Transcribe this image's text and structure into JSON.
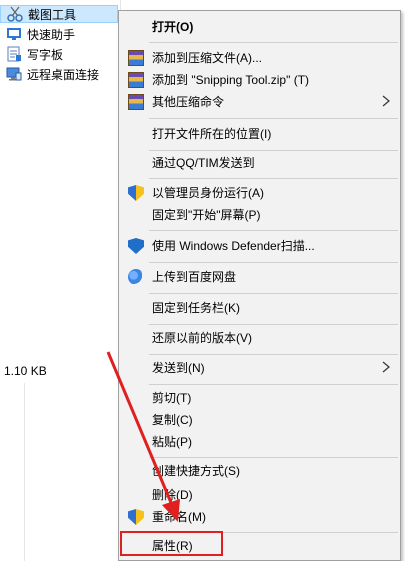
{
  "explorer": {
    "files": [
      {
        "name": "截图工具",
        "icon": "scissors-app-icon",
        "selected": true
      },
      {
        "name": "快速助手",
        "icon": "quick-assist-icon"
      },
      {
        "name": "写字板",
        "icon": "wordpad-icon"
      },
      {
        "name": "远程桌面连接",
        "icon": "remote-desktop-icon"
      }
    ],
    "size_label": "1.10 KB"
  },
  "context_menu": {
    "items": [
      {
        "label": "打开(O)",
        "bold": true,
        "icon": null
      },
      {
        "label": "添加到压缩文件(A)...",
        "icon": "archive-icon"
      },
      {
        "label": "添加到 \"Snipping Tool.zip\" (T)",
        "icon": "archive-icon"
      },
      {
        "label": "其他压缩命令",
        "icon": "archive-icon",
        "submenu": true
      },
      {
        "label": "打开文件所在的位置(I)",
        "icon": null
      },
      {
        "label": "通过QQ/TIM发送到",
        "icon": null
      },
      {
        "label": "以管理员身份运行(A)",
        "icon": "uac-shield-icon"
      },
      {
        "label": "固定到\"开始\"屏幕(P)",
        "icon": null
      },
      {
        "label": "使用 Windows Defender扫描...",
        "icon": "defender-icon"
      },
      {
        "label": "上传到百度网盘",
        "icon": "baidu-cloud-icon"
      },
      {
        "label": "固定到任务栏(K)",
        "icon": null
      },
      {
        "label": "还原以前的版本(V)",
        "icon": null
      },
      {
        "label": "发送到(N)",
        "icon": null,
        "submenu": true
      },
      {
        "label": "剪切(T)",
        "icon": null
      },
      {
        "label": "复制(C)",
        "icon": null
      },
      {
        "label": "粘贴(P)",
        "icon": null
      },
      {
        "label": "创建快捷方式(S)",
        "icon": null
      },
      {
        "label": "删除(D)",
        "icon": null
      },
      {
        "label": "重命名(M)",
        "icon": "uac-shield-icon"
      },
      {
        "label": "属性(R)",
        "icon": null,
        "highlighted": true
      }
    ]
  },
  "colors": {
    "selection": "#cce8ff",
    "menu_bg": "#f2f2f2",
    "annotation": "#e02020"
  }
}
